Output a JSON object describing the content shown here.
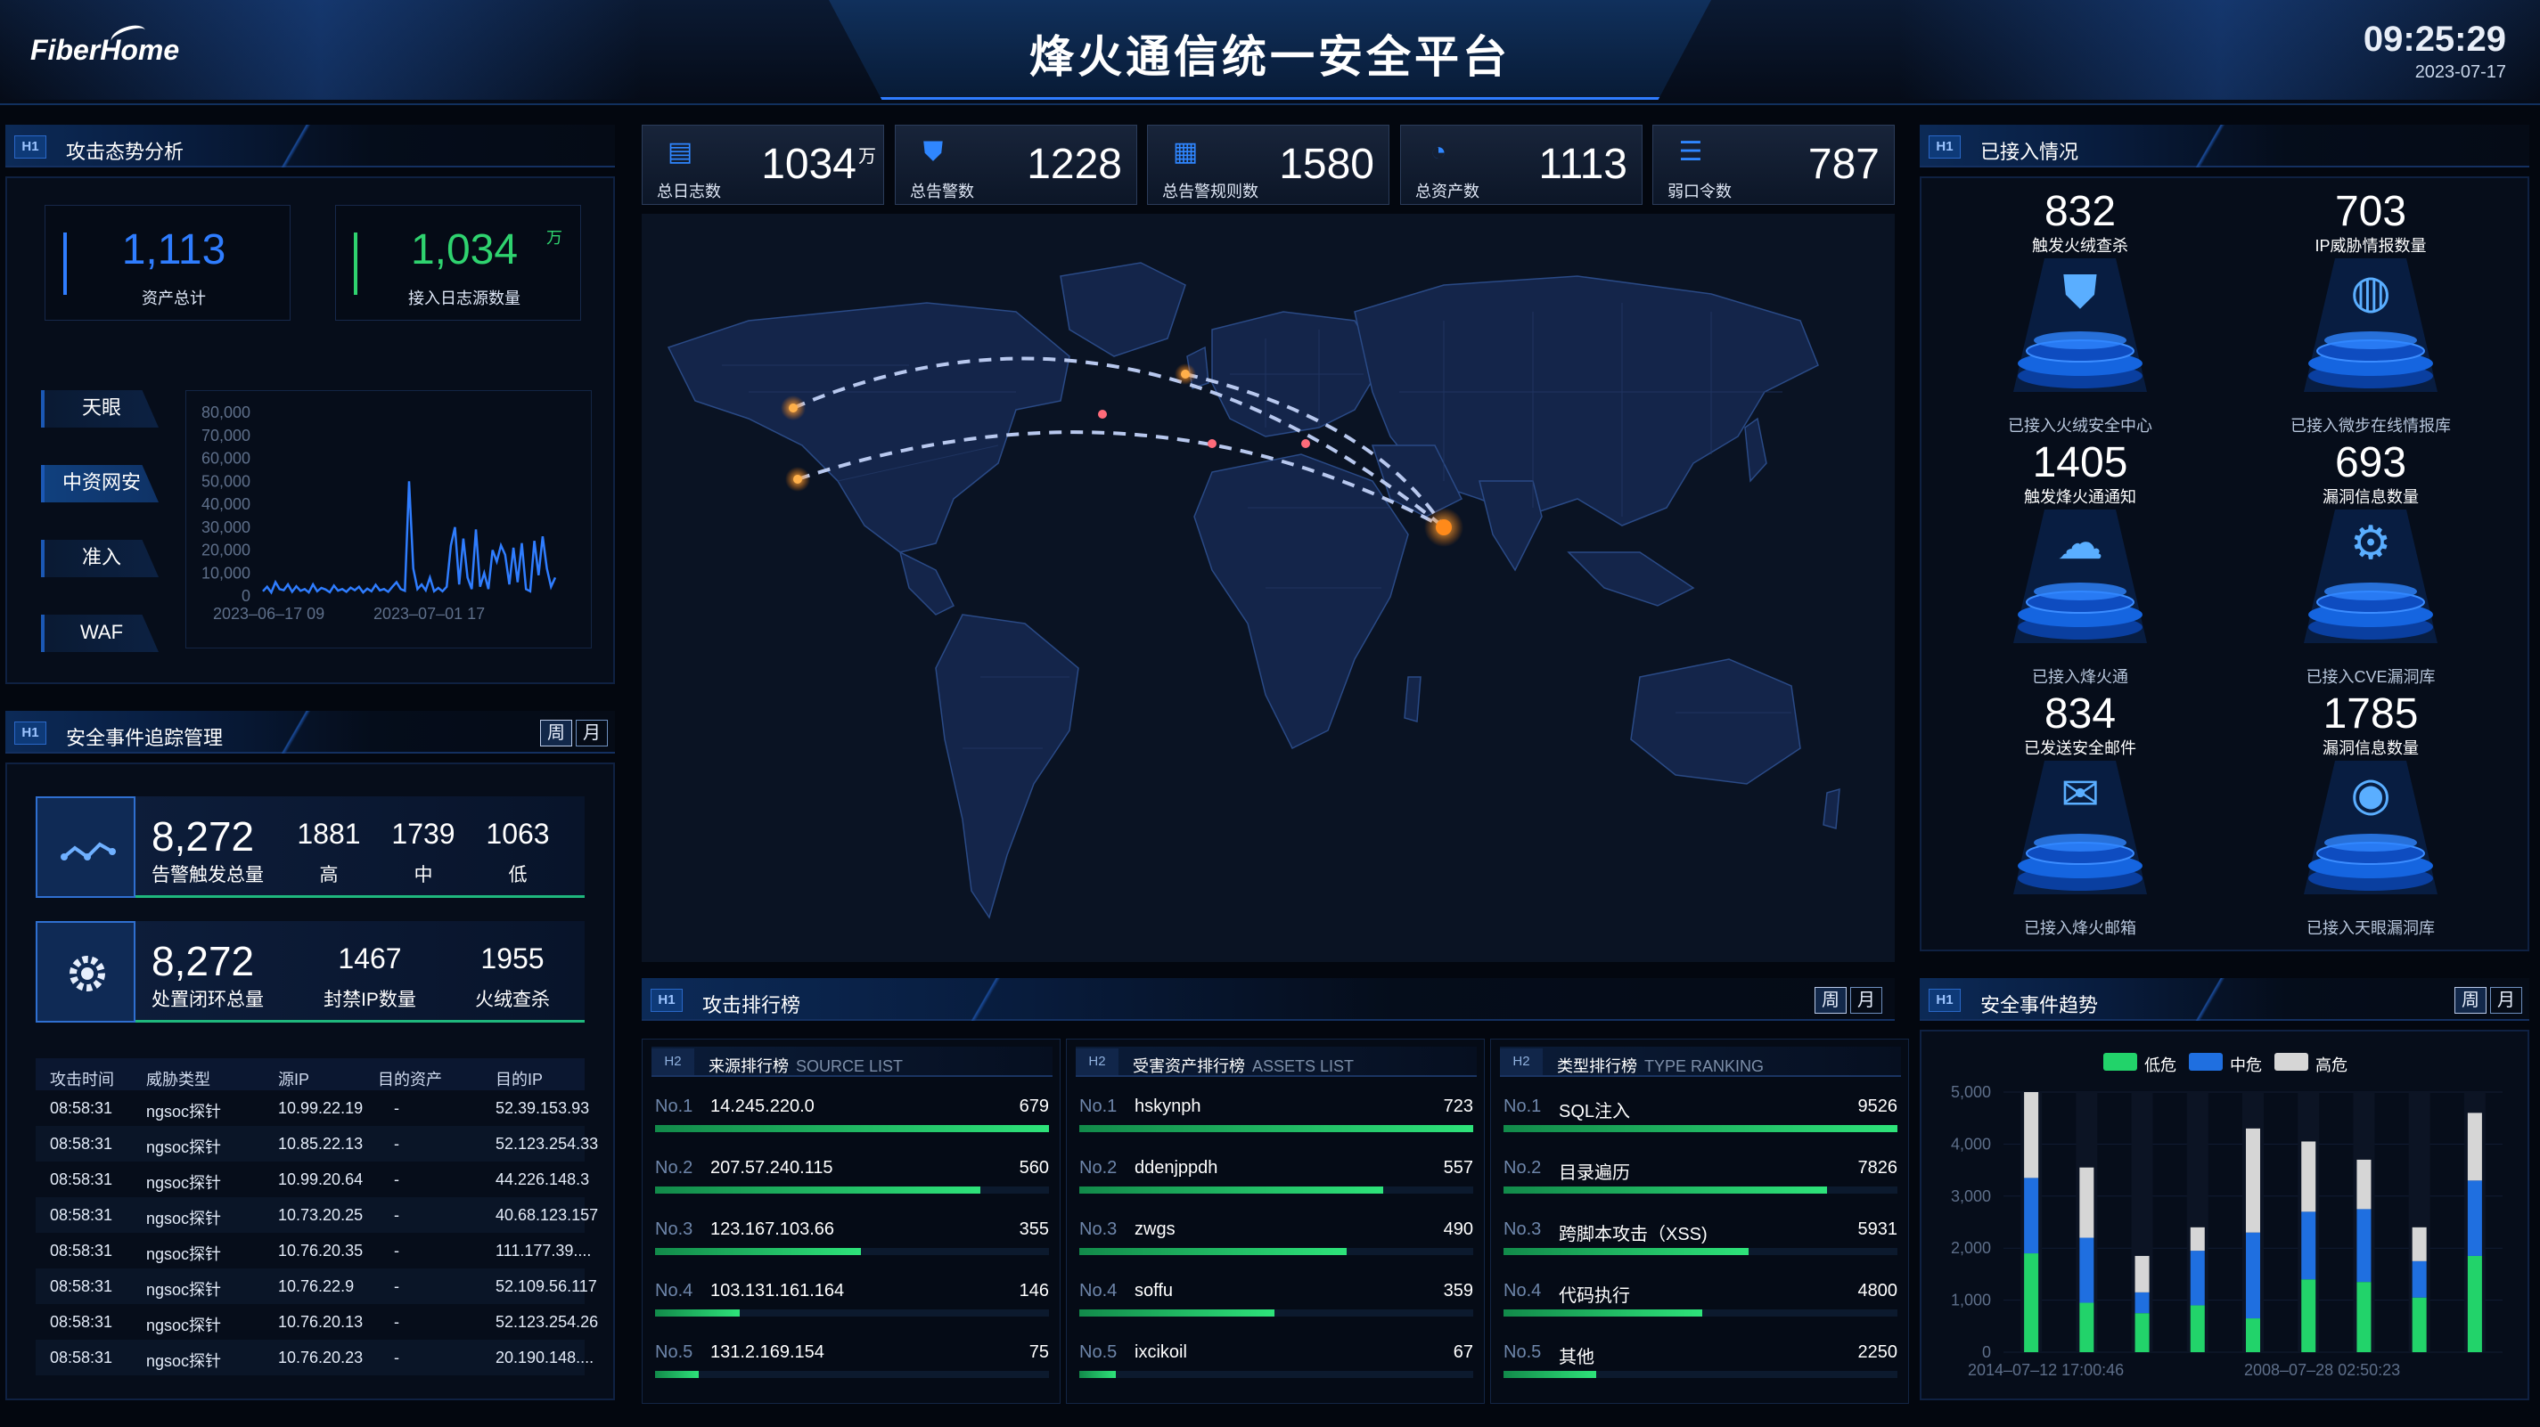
{
  "header": {
    "logo": "FiberHome",
    "title": "烽火通信统一安全平台",
    "time": "09:25:29",
    "date": "2023-07-17"
  },
  "attack_trend": {
    "badge": "H1",
    "title": "攻击态势分析",
    "kpis": [
      {
        "value": "1,113",
        "label": "资产总计",
        "color": "#2f7dff"
      },
      {
        "value": "1,034",
        "unit": "万",
        "label": "接入日志源数量",
        "color": "#2fd36f"
      }
    ],
    "tabs": [
      "天眼",
      "中资网安",
      "准入",
      "WAF"
    ],
    "active_tab": 1,
    "chart_data": {
      "type": "line",
      "ylim": [
        0,
        80000
      ],
      "yticks": [
        "80,000",
        "70,000",
        "60,000",
        "50,000",
        "40,000",
        "30,000",
        "20,000",
        "10,000",
        "0"
      ],
      "xticks": [
        "2023–06–17 09",
        "2023–07–01 17"
      ],
      "color": "#2f7dff",
      "values": [
        2000,
        4000,
        1500,
        6000,
        3000,
        2500,
        5000,
        1800,
        4200,
        2200,
        3000,
        1500,
        5000,
        2000,
        3500,
        2800,
        1600,
        4500,
        2300,
        3000,
        1800,
        3600,
        2500,
        4000,
        1500,
        3200,
        2000,
        4800,
        2400,
        3000,
        1800,
        4000,
        6000,
        3000,
        2200,
        50000,
        12000,
        3000,
        5000,
        2500,
        8000,
        2000,
        3500,
        2000,
        4000,
        22000,
        30000,
        5000,
        25000,
        8000,
        3000,
        29000,
        4000,
        10000,
        3000,
        20000,
        15000,
        22000,
        18000,
        5000,
        21000,
        6000,
        23000,
        3000,
        2000,
        24000,
        9000,
        26000,
        12000,
        4000,
        8000
      ]
    }
  },
  "event_tracking": {
    "badge": "H1",
    "title": "安全事件追踪管理",
    "toggles": [
      "周",
      "月"
    ],
    "alerts": {
      "total": "8,272",
      "total_label": "告警触发总量",
      "items": [
        {
          "value": "1881",
          "label": "高"
        },
        {
          "value": "1739",
          "label": "中"
        },
        {
          "value": "1063",
          "label": "低"
        }
      ]
    },
    "closed": {
      "total": "8,272",
      "total_label": "处置闭环总量",
      "items": [
        {
          "value": "1467",
          "label": "封禁IP数量"
        },
        {
          "value": "1955",
          "label": "火绒查杀"
        }
      ]
    },
    "table": {
      "headers": [
        "攻击时间",
        "威胁类型",
        "源IP",
        "目的资产",
        "目的IP"
      ],
      "rows": [
        [
          "08:58:31",
          "ngsoc探针",
          "10.99.22.19",
          "-",
          "52.39.153.93"
        ],
        [
          "08:58:31",
          "ngsoc探针",
          "10.85.22.13",
          "-",
          "52.123.254.33"
        ],
        [
          "08:58:31",
          "ngsoc探针",
          "10.99.20.64",
          "-",
          "44.226.148.3"
        ],
        [
          "08:58:31",
          "ngsoc探针",
          "10.73.20.25",
          "-",
          "40.68.123.157"
        ],
        [
          "08:58:31",
          "ngsoc探针",
          "10.76.20.35",
          "-",
          "111.177.39...."
        ],
        [
          "08:58:31",
          "ngsoc探针",
          "10.76.22.9",
          "-",
          "52.109.56.117"
        ],
        [
          "08:58:31",
          "ngsoc探针",
          "10.76.20.13",
          "-",
          "52.123.254.26"
        ],
        [
          "08:58:31",
          "ngsoc探针",
          "10.76.20.23",
          "-",
          "20.190.148...."
        ]
      ]
    }
  },
  "stats": [
    {
      "icon": "clipboard-icon",
      "value": "1034",
      "unit": "万",
      "label": "总日志数"
    },
    {
      "icon": "shield-check-icon",
      "value": "1228",
      "label": "总告警数"
    },
    {
      "icon": "rules-icon",
      "value": "1580",
      "label": "总告警规则数"
    },
    {
      "icon": "pie-icon",
      "value": "1113",
      "label": "总资产数"
    },
    {
      "icon": "weak-password-icon",
      "value": "787",
      "label": "弱口令数"
    }
  ],
  "access": {
    "badge": "H1",
    "title": "已接入情况",
    "items": [
      {
        "value": "832",
        "sub": "触发火绒查杀",
        "label": "已接入火绒安全中心",
        "icon": "shield-icon"
      },
      {
        "value": "703",
        "sub": "IP威胁情报数量",
        "label": "已接入微步在线情报库",
        "icon": "globe-icon"
      },
      {
        "value": "1405",
        "sub": "触发烽火通通知",
        "label": "已接入烽火通",
        "icon": "cloud-icon"
      },
      {
        "value": "693",
        "sub": "漏洞信息数量",
        "label": "已接入CVE漏洞库",
        "icon": "gear-icon"
      },
      {
        "value": "834",
        "sub": "已发送安全邮件",
        "label": "已接入烽火邮箱",
        "icon": "mail-icon"
      },
      {
        "value": "1785",
        "sub": "漏洞信息数量",
        "label": "已接入天眼漏洞库",
        "icon": "eye-icon"
      }
    ]
  },
  "attack_ranking": {
    "badge": "H1",
    "title": "攻击排行榜",
    "toggles": [
      "周",
      "月"
    ],
    "lists": [
      {
        "badge": "H2",
        "title": "来源排行榜",
        "title_en": "SOURCE LIST",
        "rows": [
          {
            "no": "No.1",
            "name": "14.245.220.0",
            "value": 679
          },
          {
            "no": "No.2",
            "name": "207.57.240.115",
            "value": 560
          },
          {
            "no": "No.3",
            "name": "123.167.103.66",
            "value": 355
          },
          {
            "no": "No.4",
            "name": "103.131.161.164",
            "value": 146
          },
          {
            "no": "No.5",
            "name": "131.2.169.154",
            "value": 75
          }
        ]
      },
      {
        "badge": "H2",
        "title": "受害资产排行榜",
        "title_en": "ASSETS LIST",
        "rows": [
          {
            "no": "No.1",
            "name": "hskynph",
            "value": 723
          },
          {
            "no": "No.2",
            "name": "ddenjppdh",
            "value": 557
          },
          {
            "no": "No.3",
            "name": "zwgs",
            "value": 490
          },
          {
            "no": "No.4",
            "name": "soffu",
            "value": 359
          },
          {
            "no": "No.5",
            "name": "ixcikoil",
            "value": 67
          }
        ]
      },
      {
        "badge": "H2",
        "title": "类型排行榜",
        "title_en": "TYPE RANKING",
        "rows": [
          {
            "no": "No.1",
            "name": "SQL注入",
            "value": 9526
          },
          {
            "no": "No.2",
            "name": "目录遍历",
            "value": 7826
          },
          {
            "no": "No.3",
            "name": "跨脚本攻击（XSS)",
            "value": 5931
          },
          {
            "no": "No.4",
            "name": "代码执行",
            "value": 4800
          },
          {
            "no": "No.5",
            "name": "其他",
            "value": 2250
          }
        ]
      }
    ]
  },
  "trend": {
    "badge": "H1",
    "title": "安全事件趋势",
    "toggles": [
      "周",
      "月"
    ],
    "chart_data": {
      "type": "bar",
      "stacked": true,
      "ylim": [
        0,
        5000
      ],
      "yticks": [
        "5,000",
        "4,000",
        "3,000",
        "2,000",
        "1,000",
        "0"
      ],
      "xticks": [
        "2014–07–12 17:00:46",
        "2008–07–28 02:50:23"
      ],
      "series": [
        {
          "name": "低危",
          "color": "#22d36a",
          "values": [
            1900,
            950,
            750,
            900,
            650,
            1400,
            1350,
            1050,
            1850
          ]
        },
        {
          "name": "中危",
          "color": "#1f6fe0",
          "values": [
            1450,
            1250,
            400,
            1050,
            1650,
            1300,
            1400,
            700,
            1450
          ]
        },
        {
          "name": "高危",
          "color": "#d6d6d6",
          "values": [
            1650,
            1350,
            700,
            450,
            2000,
            1350,
            950,
            650,
            1300
          ]
        }
      ]
    }
  }
}
